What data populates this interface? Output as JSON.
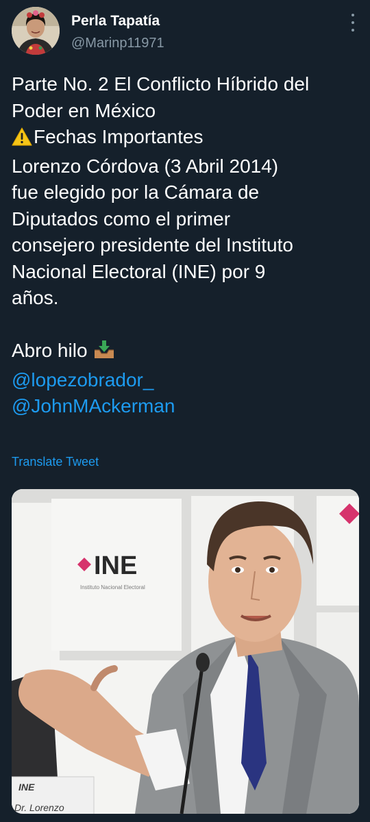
{
  "author": {
    "name": "Perla Tapatía",
    "handle": "@Marinp11971",
    "avatar_icon": "profile-avatar"
  },
  "menu_icon": "more-vertical-icon",
  "tweet": {
    "lines": [
      "Parte No. 2 El Conflicto Híbrido del",
      "Poder en México",
      "Fechas Importantes",
      "Lorenzo Córdova (3 Abril 2014)",
      "fue elegido por la Cámara de",
      "Diputados como el primer",
      "consejero presidente del Instituto",
      "Nacional Electoral (INE) por 9",
      "años.",
      "Abro hilo"
    ],
    "warning_icon": "warning-icon",
    "thread_icon": "inbox-tray-icon",
    "mentions": [
      "@lopezobrador_",
      "@JohnMAckerman"
    ]
  },
  "translate_label": "Translate Tweet",
  "photo": {
    "sign_text": "INE",
    "sign_subtext": "Instituto Nacional Electoral",
    "nameplate_logo": "INE",
    "nameplate_text": "Dr. Lorenzo"
  },
  "colors": {
    "background": "#15202b",
    "link": "#1d9bf0",
    "secondary_text": "#8899a6",
    "ine_pink": "#d6336c"
  }
}
